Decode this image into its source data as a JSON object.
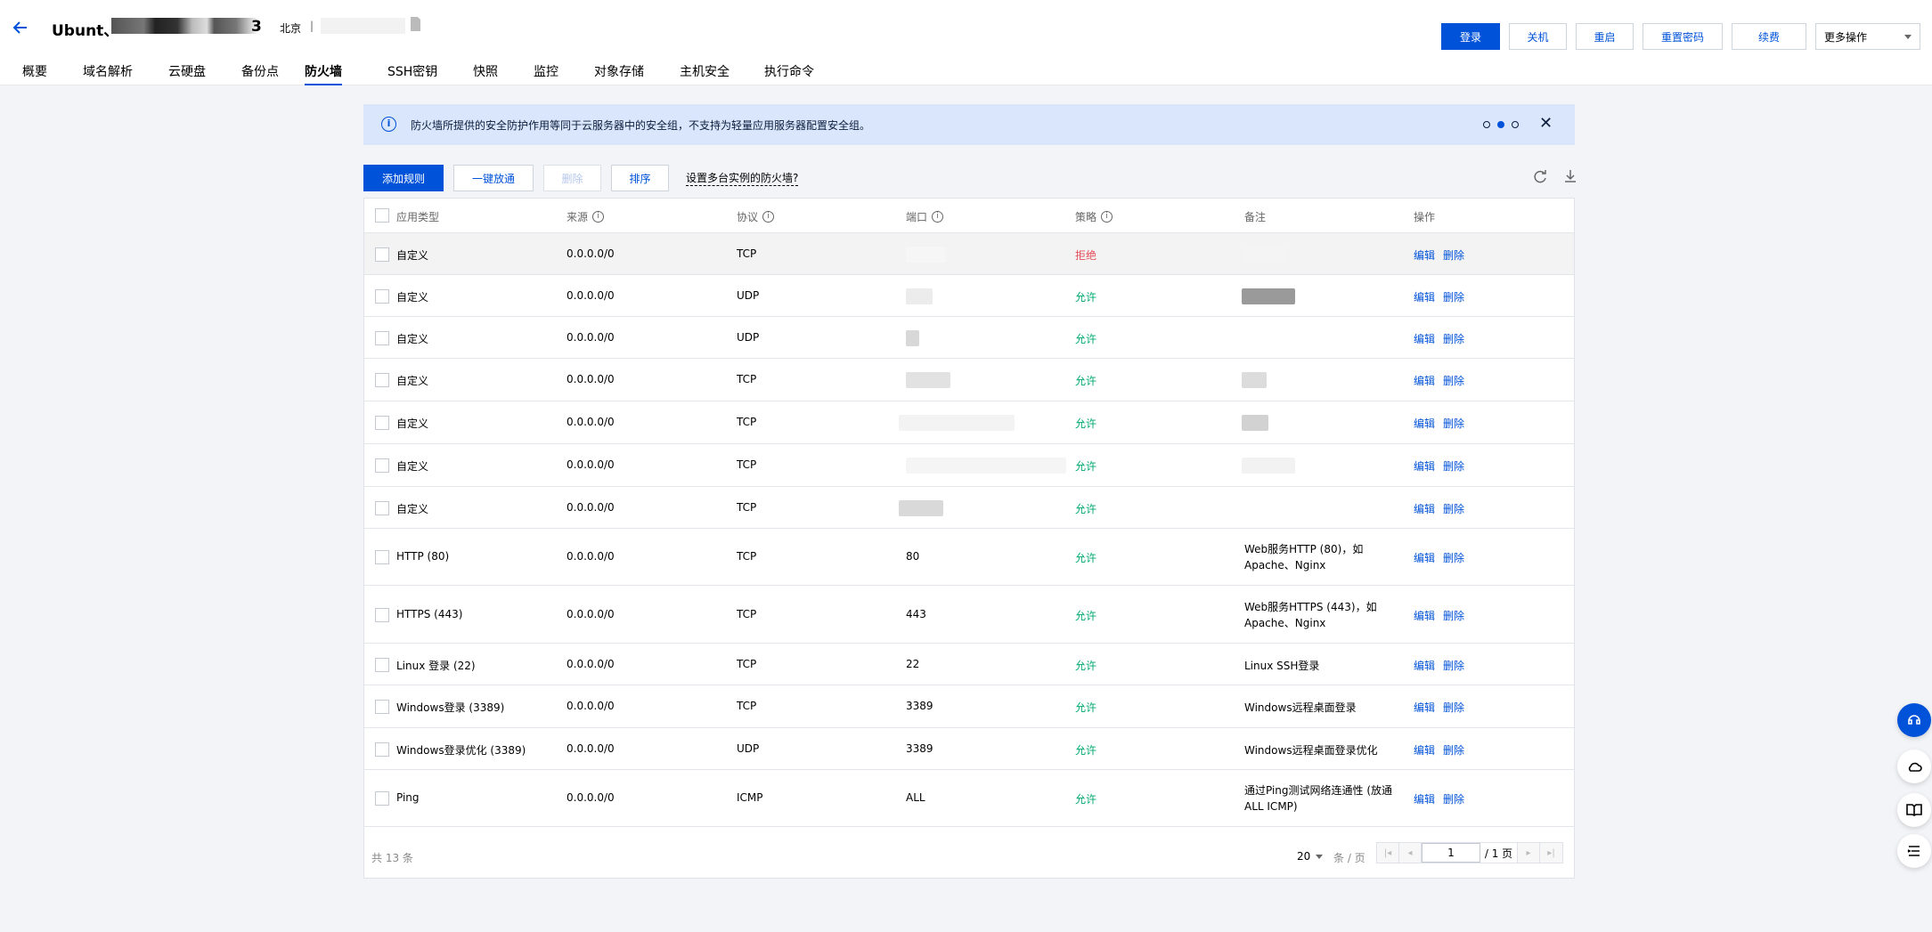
{
  "header": {
    "title": "Ubunt、",
    "title_suffix": "3",
    "region": "北京",
    "region_sep": "|",
    "buttons": {
      "login": "登录",
      "shutdown": "关机",
      "restart": "重启",
      "reset_password": "重置密码",
      "renew": "续费",
      "more": "更多操作"
    }
  },
  "tabs": [
    "概要",
    "域名解析",
    "云硬盘",
    "备份点",
    "防火墙",
    "SSH密钥",
    "快照",
    "监控",
    "对象存储",
    "主机安全",
    "执行命令"
  ],
  "active_tab": "防火墙",
  "notice": {
    "icon": "i",
    "text": "防火墙所提供的安全防护作用等同于云服务器中的安全组，不支持为轻量应用服务器配置安全组。",
    "close": "✕"
  },
  "toolbar": {
    "add_rule": "添加规则",
    "one_click_open": "一键放通",
    "delete": "删除",
    "sort": "排序",
    "multi_instance_link": "设置多台实例的防火墙?"
  },
  "table": {
    "headers": {
      "app_type": "应用类型",
      "source": "来源",
      "protocol": "协议",
      "port": "端口",
      "policy": "策略",
      "note": "备注",
      "actions": "操作"
    },
    "edit_label": "编辑",
    "delete_label": "删除",
    "rows": [
      {
        "app": "自定义",
        "source": "0.0.0.0/0",
        "protocol": "TCP",
        "port": "",
        "policy": "拒绝",
        "note": "",
        "policy_type": "deny"
      },
      {
        "app": "自定义",
        "source": "0.0.0.0/0",
        "protocol": "UDP",
        "port": "",
        "policy": "允许",
        "note": "",
        "policy_type": "allow"
      },
      {
        "app": "自定义",
        "source": "0.0.0.0/0",
        "protocol": "UDP",
        "port": "",
        "policy": "允许",
        "note": "",
        "policy_type": "allow"
      },
      {
        "app": "自定义",
        "source": "0.0.0.0/0",
        "protocol": "TCP",
        "port": "",
        "policy": "允许",
        "note": "",
        "policy_type": "allow"
      },
      {
        "app": "自定义",
        "source": "0.0.0.0/0",
        "protocol": "TCP",
        "port": "",
        "policy": "允许",
        "note": "",
        "policy_type": "allow"
      },
      {
        "app": "自定义",
        "source": "0.0.0.0/0",
        "protocol": "TCP",
        "port": "",
        "policy": "允许",
        "note": "",
        "policy_type": "allow"
      },
      {
        "app": "自定义",
        "source": "0.0.0.0/0",
        "protocol": "TCP",
        "port": "",
        "policy": "允许",
        "note": "",
        "policy_type": "allow"
      },
      {
        "app": "HTTP (80)",
        "source": "0.0.0.0/0",
        "protocol": "TCP",
        "port": "80",
        "policy": "允许",
        "note": "Web服务HTTP (80)，如Apache、Nginx",
        "policy_type": "allow"
      },
      {
        "app": "HTTPS (443)",
        "source": "0.0.0.0/0",
        "protocol": "TCP",
        "port": "443",
        "policy": "允许",
        "note": "Web服务HTTPS (443)，如Apache、Nginx",
        "policy_type": "allow"
      },
      {
        "app": "Linux 登录 (22)",
        "source": "0.0.0.0/0",
        "protocol": "TCP",
        "port": "22",
        "policy": "允许",
        "note": "Linux SSH登录",
        "policy_type": "allow"
      },
      {
        "app": "Windows登录 (3389)",
        "source": "0.0.0.0/0",
        "protocol": "TCP",
        "port": "3389",
        "policy": "允许",
        "note": "Windows远程桌面登录",
        "policy_type": "allow"
      },
      {
        "app": "Windows登录优化 (3389)",
        "source": "0.0.0.0/0",
        "protocol": "UDP",
        "port": "3389",
        "policy": "允许",
        "note": "Windows远程桌面登录优化",
        "policy_type": "allow"
      },
      {
        "app": "Ping",
        "source": "0.0.0.0/0",
        "protocol": "ICMP",
        "port": "ALL",
        "policy": "允许",
        "note": "通过Ping测试网络连通性 (放通ALL ICMP)",
        "policy_type": "allow"
      }
    ]
  },
  "footer": {
    "total": "共 13 条",
    "page_size": "20",
    "per_page": "条 / 页",
    "current_page": "1",
    "total_pages": "/ 1 页"
  },
  "colors": {
    "primary": "#0052d9",
    "allow": "#00a870",
    "deny": "#e34d59",
    "notice_bg": "#d9e6fb"
  }
}
